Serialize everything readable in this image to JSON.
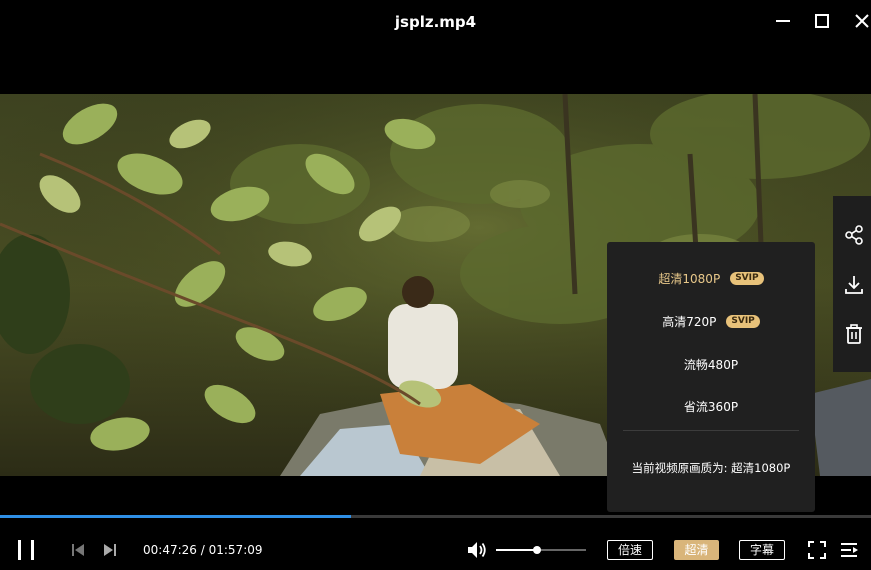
{
  "window": {
    "title": "jsplz.mp4"
  },
  "playback": {
    "current_time": "00:47:26",
    "separator": "/",
    "duration": "01:57:09",
    "progress_fraction": 0.403,
    "volume_fraction": 0.46
  },
  "quality_menu": {
    "options": [
      {
        "label": "超清1080P",
        "badge": "SVIP",
        "selected": true
      },
      {
        "label": "高清720P",
        "badge": "SVIP",
        "selected": false
      },
      {
        "label": "流畅480P",
        "badge": "",
        "selected": false
      },
      {
        "label": "省流360P",
        "badge": "",
        "selected": false
      }
    ],
    "current_label": "当前视频原画质为: 超清1080P"
  },
  "controls": {
    "speed_label": "倍速",
    "quality_label": "超清",
    "subtitle_label": "字幕"
  },
  "icons": {
    "side_tools": [
      "share-icon",
      "download-icon",
      "trash-icon"
    ],
    "bottom": [
      "pause-icon",
      "prev-icon",
      "next-icon",
      "volume-icon",
      "fullscreen-icon",
      "playlist-icon"
    ]
  },
  "colors": {
    "progress": "#2f8fe6",
    "accent_gold": "#d9b57a",
    "selected_text": "#e8c88a",
    "svip_badge": "#e8c27a",
    "menu_bg": "#202020"
  }
}
